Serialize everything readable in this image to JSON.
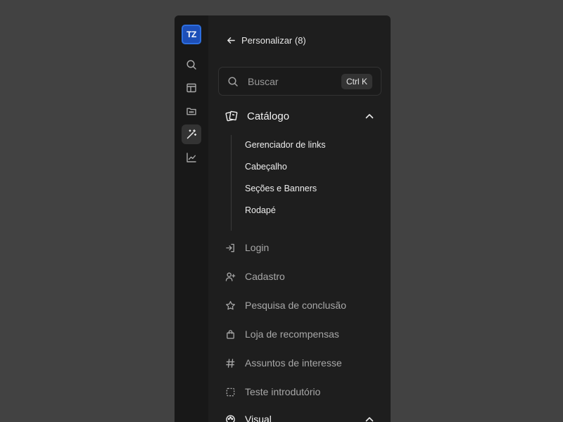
{
  "rail": {
    "logo_text": "TZ",
    "items": [
      {
        "icon": "search-icon",
        "active": false
      },
      {
        "icon": "layout-icon",
        "active": false
      },
      {
        "icon": "folder-icon",
        "active": false
      },
      {
        "icon": "magic-wand-icon",
        "active": true
      },
      {
        "icon": "chart-line-icon",
        "active": false
      }
    ]
  },
  "header": {
    "back_label": "Personalizar (8)"
  },
  "search": {
    "placeholder": "Buscar",
    "shortcut": "Ctrl K"
  },
  "catalog": {
    "title": "Catálogo",
    "items": [
      "Gerenciador de links",
      "Cabeçalho",
      "Seções e Banners",
      "Rodapé"
    ]
  },
  "nav": [
    {
      "label": "Login",
      "icon": "login-icon"
    },
    {
      "label": "Cadastro",
      "icon": "user-plus-icon"
    },
    {
      "label": "Pesquisa de conclusão",
      "icon": "star-icon"
    },
    {
      "label": "Loja de recompensas",
      "icon": "shopping-bag-icon"
    },
    {
      "label": "Assuntos de interesse",
      "icon": "hash-icon"
    },
    {
      "label": "Teste introdutório",
      "icon": "dashed-square-icon"
    }
  ],
  "visual": {
    "title": "Visual"
  },
  "colors": {
    "background": "#424242",
    "panel": "#1e1e1e",
    "rail": "#181818",
    "accent": "#2d6fe0"
  }
}
